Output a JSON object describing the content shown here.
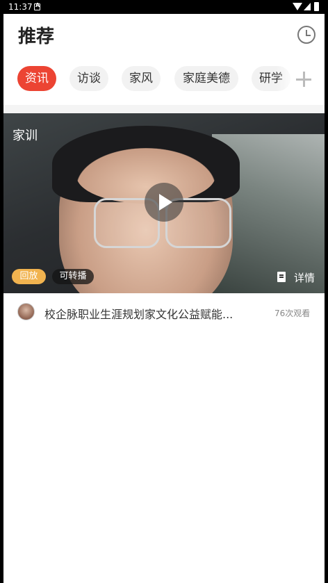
{
  "status_bar": {
    "time": "11:37"
  },
  "header": {
    "title": "推荐"
  },
  "tabs": [
    {
      "label": "资讯",
      "active": true
    },
    {
      "label": "访谈",
      "active": false
    },
    {
      "label": "家风",
      "active": false
    },
    {
      "label": "家庭美德",
      "active": false
    },
    {
      "label": "研学",
      "active": false
    }
  ],
  "icons": {
    "history": "history-clock-icon",
    "add_tab": "plus-icon",
    "play": "play-icon",
    "detail": "document-icon"
  },
  "video": {
    "overlay_label": "家训",
    "badge_replay": "回放",
    "badge_forward": "可转播",
    "detail_label": "详情"
  },
  "video_info": {
    "title": "校企脉职业生涯规划家文化公益赋能...",
    "views": "76次观看"
  },
  "colors": {
    "accent": "#ec4433",
    "replay_badge": "#f1b34f"
  }
}
